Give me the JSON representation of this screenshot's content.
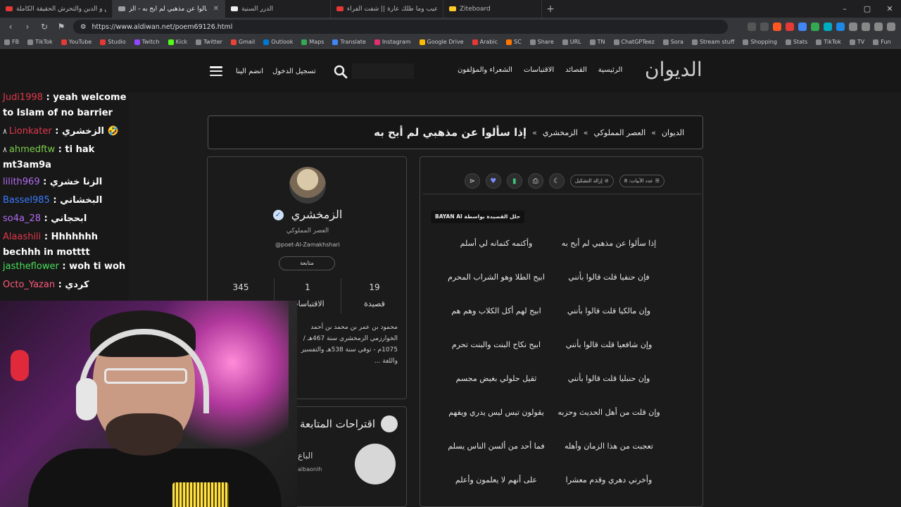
{
  "browser": {
    "tabs": [
      {
        "title": "العراق و الدين والتحرش الحقيقة الكاملة",
        "color": "#e53935",
        "active": false
      },
      {
        "title": "إذا سألوا عن مذهبي لم أبح به - الز",
        "color": "#9e9e9e",
        "active": true
      },
      {
        "title": "الدرر السنية",
        "color": "#eeeeee",
        "active": false
      },
      {
        "title": "يا قمر عيب وما طلك عارة || شفت الفراء",
        "color": "#e53935",
        "active": false
      },
      {
        "title": "Ziteboard",
        "color": "#ffca28",
        "active": false
      }
    ],
    "url": "https://www.aldiwan.net/poem69126.html",
    "bookmarks": [
      {
        "label": "FB",
        "color": "#888"
      },
      {
        "label": "TikTok",
        "color": "#888"
      },
      {
        "label": "YouTube",
        "color": "#e53935"
      },
      {
        "label": "Studio",
        "color": "#e53935"
      },
      {
        "label": "Twitch",
        "color": "#9146ff"
      },
      {
        "label": "Kick",
        "color": "#53fc18"
      },
      {
        "label": "Twitter",
        "color": "#888"
      },
      {
        "label": "Gmail",
        "color": "#ea4335"
      },
      {
        "label": "Outlook",
        "color": "#0078d4"
      },
      {
        "label": "Maps",
        "color": "#34a853"
      },
      {
        "label": "Translate",
        "color": "#4285f4"
      },
      {
        "label": "Instagram",
        "color": "#e1306c"
      },
      {
        "label": "Google Drive",
        "color": "#fbbc04"
      },
      {
        "label": "Arabic",
        "color": "#e53935"
      },
      {
        "label": "SC",
        "color": "#ff7700"
      },
      {
        "label": "Share",
        "color": "#888"
      },
      {
        "label": "URL",
        "color": "#888"
      },
      {
        "label": "TN",
        "color": "#888"
      },
      {
        "label": "ChatGPTeez",
        "color": "#888"
      },
      {
        "label": "Sora",
        "color": "#888"
      },
      {
        "label": "Stream stuff",
        "color": "#888"
      },
      {
        "label": "Shopping",
        "color": "#888"
      },
      {
        "label": "Stats",
        "color": "#888"
      },
      {
        "label": "TikTok",
        "color": "#888"
      },
      {
        "label": "TV",
        "color": "#888"
      },
      {
        "label": "Fun",
        "color": "#888"
      }
    ]
  },
  "site": {
    "logo": "الديوان",
    "nav": [
      "الرئيسية",
      "القصائد",
      "الاقتباسات",
      "الشعراء والمؤلفون"
    ],
    "login": "تسجيل الدخول",
    "join": "انضم الينا",
    "breadcrumb": [
      "الديوان",
      "العصر المملوكي",
      "الزمخشري",
      "إذا سألوا عن مذهبي لم أبح به"
    ],
    "breadcrumb_sep": "»"
  },
  "poet": {
    "name": "الزمخشري",
    "era": "العصر المملوكي",
    "handle": "@poet-Al-Zamakhshari",
    "follow": "متابعة",
    "stats": [
      {
        "num": "19",
        "label": "قصيدة"
      },
      {
        "num": "1",
        "label": "الاقتباسات"
      },
      {
        "num": "345",
        "label": ""
      }
    ],
    "bio": "محمود بن عمر بن محمد بن أحمد الخوارزمي الزمخشري سنة 467هـ / 1075م - توفي سنة 538هـ والتفسير واللغة ..."
  },
  "suggestions": {
    "title": "اقتراحات المتابعة",
    "name": "الباع",
    "handle": "albaonih"
  },
  "poem": {
    "verse_count": "عدد الأبيات: 8",
    "remove_diacritics": "إزالة التشكيل",
    "bayan": "حلل القصيدة بواسطة BAYAN AI",
    "verses": [
      [
        "إذا سألوا عن مذهبي لم أبح به",
        "وأكتمه كتمانه لي أسلم"
      ],
      [
        "فإن حنفيا قلت قالوا بأنني",
        "ابيح الطلا وهو الشراب المحرم"
      ],
      [
        "وإن مالكيا قلت قالوا بأنني",
        "ابيح لهم أكل الكلاب وهم هم"
      ],
      [
        "وإن شافعيا قلت قالوا بأنني",
        "ابيح نكاح البنت والبنت تحرم"
      ],
      [
        "وإن حنبليا قلت قالوا بأنني",
        "ثقيل حلولي بغيض مجسم"
      ],
      [
        "وإن قلت من أهل الحديث وحزبه",
        "يقولون تيس ليس يدري ويفهم"
      ],
      [
        "تعجبت من هذا الزمان وأهله",
        "فما أحد من ألسن الناس يسلم"
      ],
      [
        "وأخرني دهري وقدم معشرا",
        "على أنهم لا يعلمون وأعلم"
      ]
    ]
  },
  "chat": [
    {
      "lead": "",
      "user": "Judi1998",
      "color": "#e0384b",
      "msg": "yeah welcome to Islam of no barrier"
    },
    {
      "lead": "٨",
      "user": "Lionkater",
      "color": "#e0384b",
      "msg": "الزخشري 🤣"
    },
    {
      "lead": "٨",
      "user": "ahmedftw",
      "color": "#7bd04a",
      "msg": "ti hak mt3am9a"
    },
    {
      "lead": "",
      "user": "lilith969",
      "color": "#b36cf2",
      "msg": "الزنا خشري"
    },
    {
      "lead": "",
      "user": "Bassel985",
      "color": "#3b7bff",
      "msg": "البخشاني"
    },
    {
      "lead": "",
      "user": "so4a_28",
      "color": "#b36cf2",
      "msg": "ابحجاني"
    },
    {
      "lead": "",
      "user": "Alaashili",
      "color": "#e0384b",
      "msg": "Hhhhhhh bechhh in motttt"
    },
    {
      "lead": "",
      "user": "jastheflower",
      "color": "#46e05a",
      "msg": "woh ti woh"
    },
    {
      "lead": "",
      "user": "Octo_Yazan",
      "color": "#ff5a7a",
      "msg": "كردي"
    }
  ]
}
